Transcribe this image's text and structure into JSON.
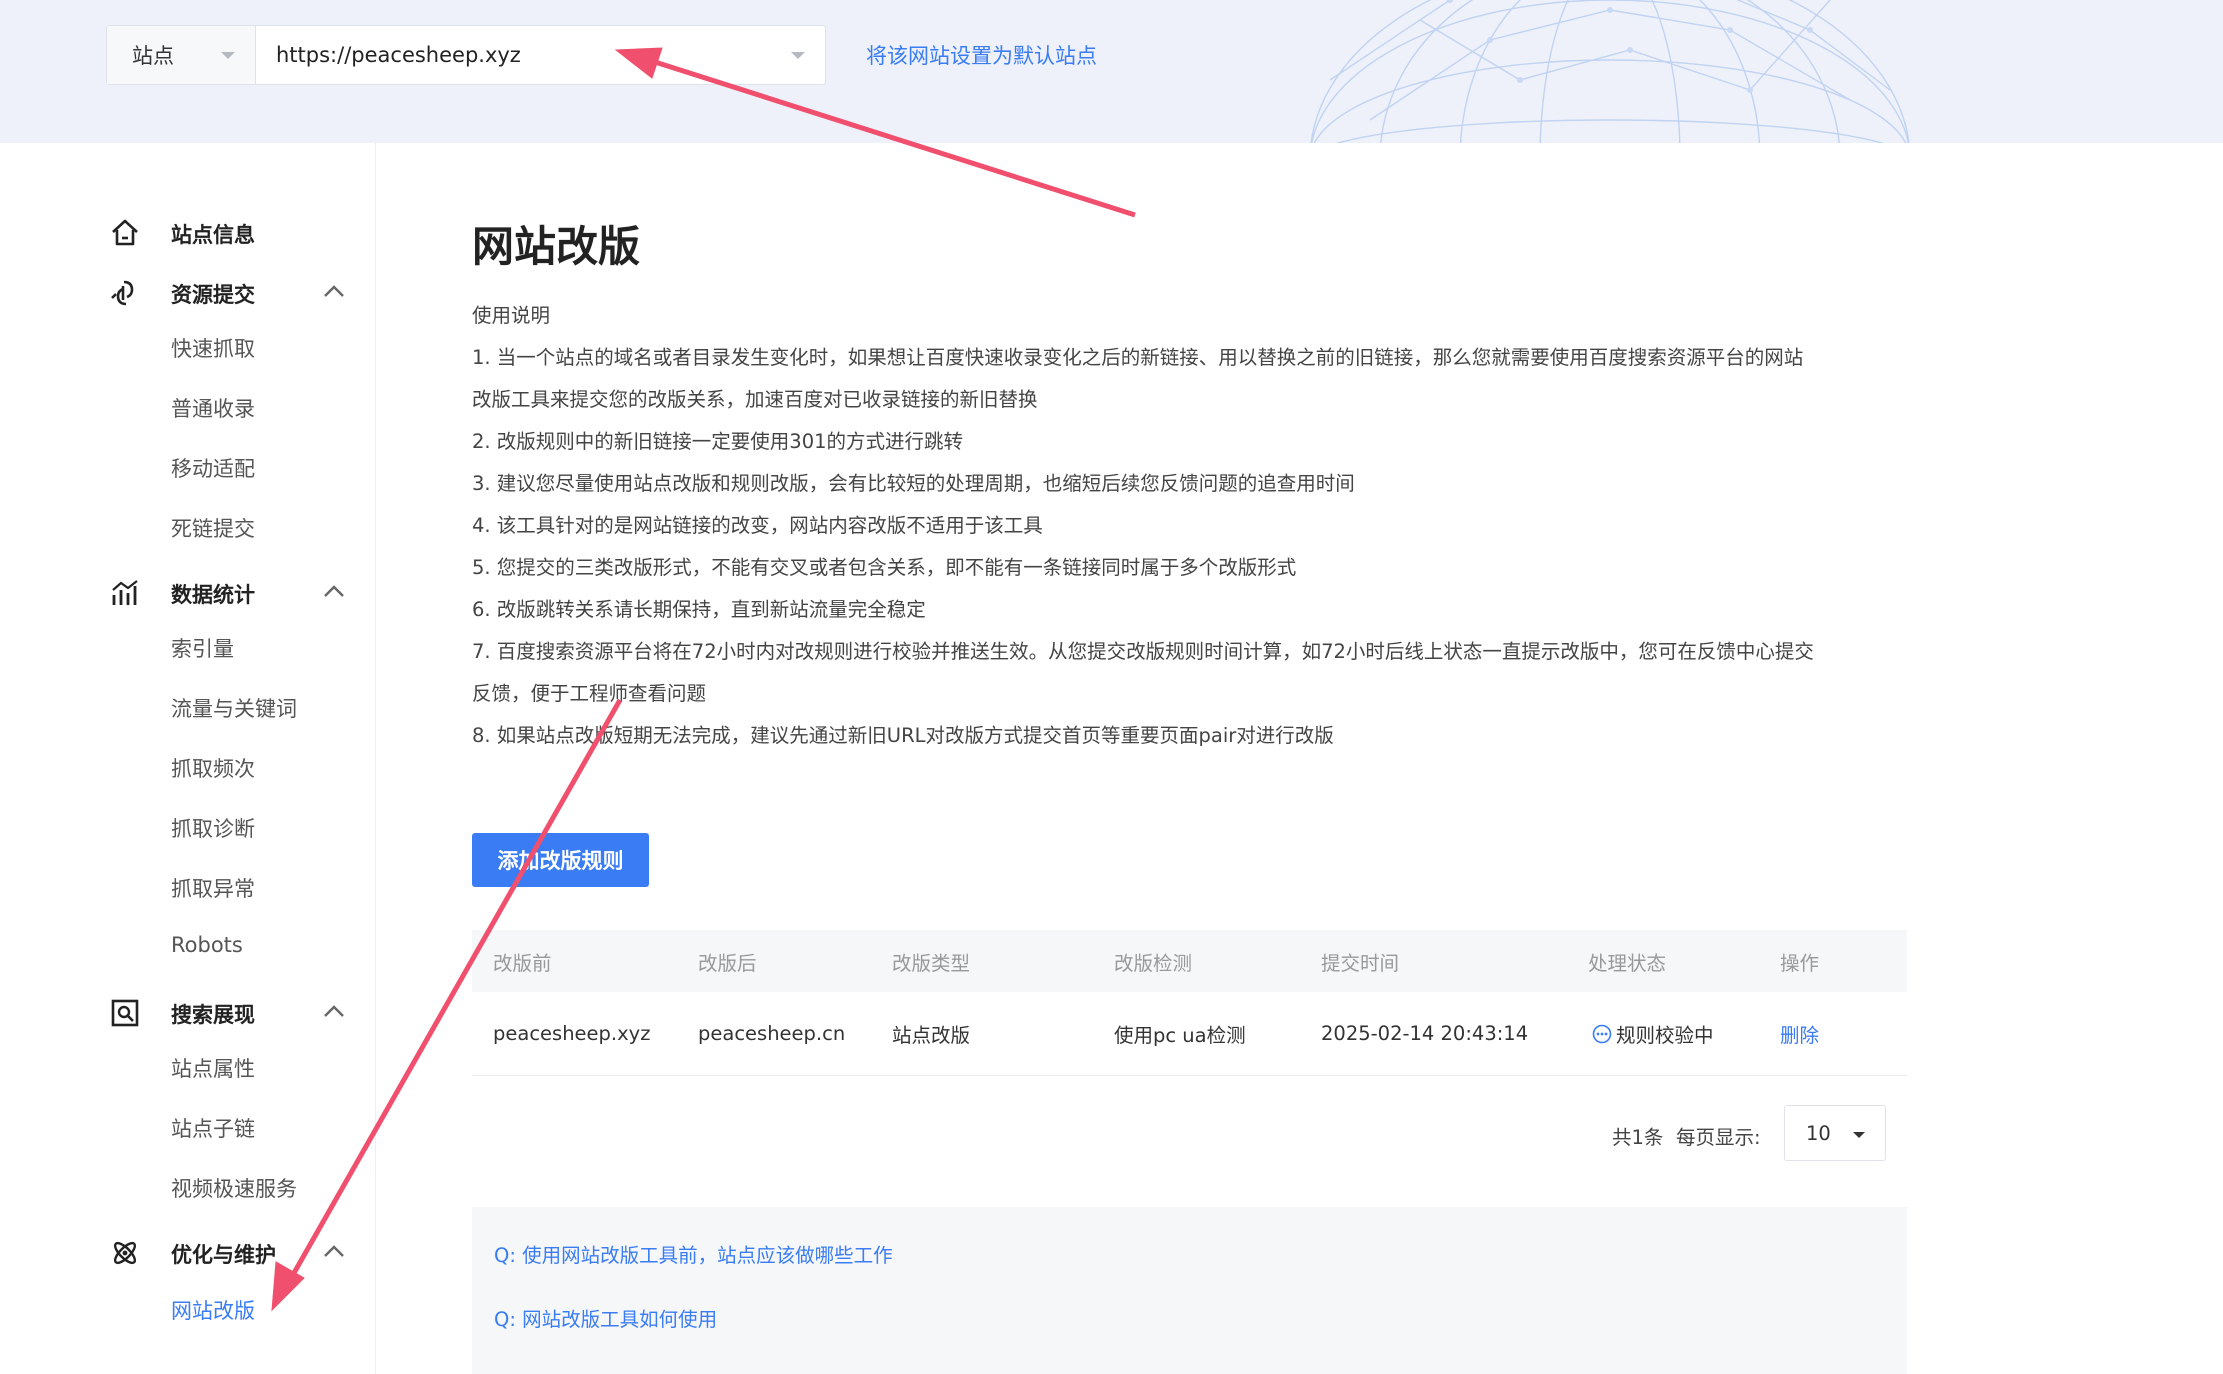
{
  "header": {
    "site_type_label": "站点",
    "site_url": "https://peacesheep.xyz",
    "set_default_link": "将该网站设置为默认站点"
  },
  "sidebar": {
    "site_info": "站点信息",
    "resource_submit": {
      "label": "资源提交",
      "items": [
        "快速抓取",
        "普通收录",
        "移动适配",
        "死链提交"
      ]
    },
    "data_stats": {
      "label": "数据统计",
      "items": [
        "索引量",
        "流量与关键词",
        "抓取频次",
        "抓取诊断",
        "抓取异常",
        "Robots"
      ]
    },
    "search_display": {
      "label": "搜索展现",
      "items": [
        "站点属性",
        "站点子链",
        "视频极速服务"
      ]
    },
    "optimize": {
      "label": "优化与维护",
      "items": [
        "网站改版"
      ]
    }
  },
  "main": {
    "title": "网站改版",
    "instructions": [
      "使用说明",
      "1. 当一个站点的域名或者目录发生变化时，如果想让百度快速收录变化之后的新链接、用以替换之前的旧链接，那么您就需要使用百度搜索资源平台的网站",
      "改版工具来提交您的改版关系，加速百度对已收录链接的新旧替换",
      "2. 改版规则中的新旧链接一定要使用301的方式进行跳转",
      "3. 建议您尽量使用站点改版和规则改版，会有比较短的处理周期，也缩短后续您反馈问题的追查用时间",
      "4. 该工具针对的是网站链接的改变，网站内容改版不适用于该工具",
      "5. 您提交的三类改版形式，不能有交叉或者包含关系，即不能有一条链接同时属于多个改版形式",
      "6. 改版跳转关系请长期保持，直到新站流量完全稳定",
      "7. 百度搜索资源平台将在72小时内对改规则进行校验并推送生效。从您提交改版规则时间计算，如72小时后线上状态一直提示改版中，您可在反馈中心提交",
      "反馈，便于工程师查看问题",
      "8. 如果站点改版短期无法完成，建议先通过新旧URL对改版方式提交首页等重要页面pair对进行改版"
    ],
    "add_button": "添加改版规则",
    "table": {
      "headers": [
        "改版前",
        "改版后",
        "改版类型",
        "改版检测",
        "提交时间",
        "处理状态",
        "操作"
      ],
      "rows": [
        [
          "peacesheep.xyz",
          "peacesheep.cn",
          "站点改版",
          "使用pc ua检测",
          "2025-02-14 20:43:14",
          "规则校验中",
          "删除"
        ]
      ]
    },
    "pagination": {
      "total": "共1条",
      "per_page_label": "每页显示:",
      "per_page_value": "10"
    },
    "faq": [
      "Q:  使用网站改版工具前，站点应该做哪些工作",
      "Q:  网站改版工具如何使用"
    ]
  },
  "colors": {
    "accent": "#3a7cf3",
    "annotation_arrow": "#f0506e",
    "header_bg": "#eef1f9"
  }
}
